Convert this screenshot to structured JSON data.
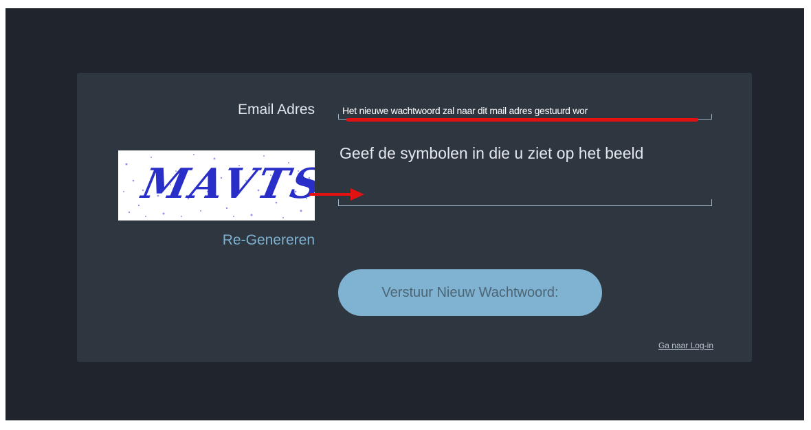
{
  "form": {
    "email_label": "Email Adres",
    "email_value": "Het nieuwe wachtwoord zal naar dit mail adres gestuurd wor",
    "captcha_text": "MAVTS",
    "captcha_hint": "Geef de symbolen in die u ziet op het beeld",
    "captcha_input_value": "",
    "regenerate_label": "Re-Genereren",
    "submit_label": "Verstuur Nieuw Wachtwoord:",
    "login_link": "Ga naar Log-in"
  },
  "colors": {
    "app_background": "#20252d",
    "card_background": "#2e3640",
    "accent_button": "#7fb3d1",
    "link": "#7fb1d0",
    "annotation_red": "#e01212",
    "captcha_text": "#2a2ec8"
  }
}
